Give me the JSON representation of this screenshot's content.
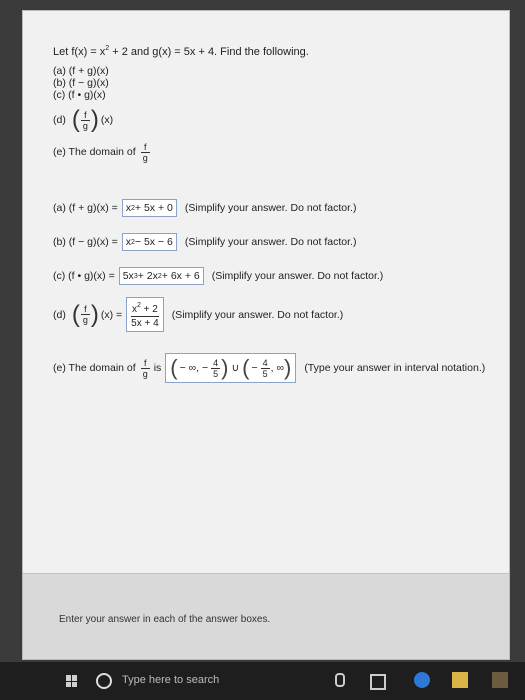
{
  "prompt": {
    "lead": "Let f(x) = x",
    "exp": "2",
    "rest": " + 2 and g(x) = 5x + 4. Find the following."
  },
  "parts": {
    "a": "(a) (f + g)(x)",
    "b": "(b) (f − g)(x)",
    "c": "(c) (f • g)(x)",
    "d_label": "(d)",
    "d_suffix": "(x)",
    "e_label": "(e) The domain of"
  },
  "symbols": {
    "f": "f",
    "g": "g",
    "open": "(",
    "close": ")"
  },
  "answers": {
    "a": {
      "label": "(a) (f + g)(x) =",
      "value_base": "x",
      "value_exp": "2",
      "value_rest": " + 5x + 0",
      "hint": "(Simplify your answer. Do not factor.)"
    },
    "b": {
      "label": "(b) (f − g)(x) =",
      "value_base": "x",
      "value_exp": "2",
      "value_rest": " − 5x − 6",
      "hint": "(Simplify your answer. Do not factor.)"
    },
    "c": {
      "label": "(c) (f • g)(x) =",
      "v1": "5x",
      "e1": "3",
      "v2": " + 2x",
      "e2": "2",
      "v3": " + 6x + 6",
      "hint": "(Simplify your answer. Do not factor.)"
    },
    "d": {
      "label": "(d)",
      "mid": "(x) =",
      "num_base": "x",
      "num_exp": "2",
      "num_rest": " + 2",
      "den": "5x + 4",
      "hint": "(Simplify your answer. Do not factor.)"
    },
    "e": {
      "label": "(e) The domain of",
      "is": "is",
      "left_open": "(",
      "neg_inf": "− ∞, −",
      "frac_num": "4",
      "frac_den": "5",
      "union": "∪",
      "neg": "−",
      "inf": ", ∞",
      "right_close": ")",
      "hint": "(Type your answer in interval notation.)"
    }
  },
  "footer": {
    "text": "Enter your answer in each of the answer boxes."
  },
  "taskbar": {
    "search_placeholder": "Type here to search",
    "icons": [
      "windows-icon",
      "search-icon",
      "microphone-icon",
      "task-view-icon",
      "edge-icon",
      "file-explorer-icon",
      "store-icon"
    ]
  }
}
